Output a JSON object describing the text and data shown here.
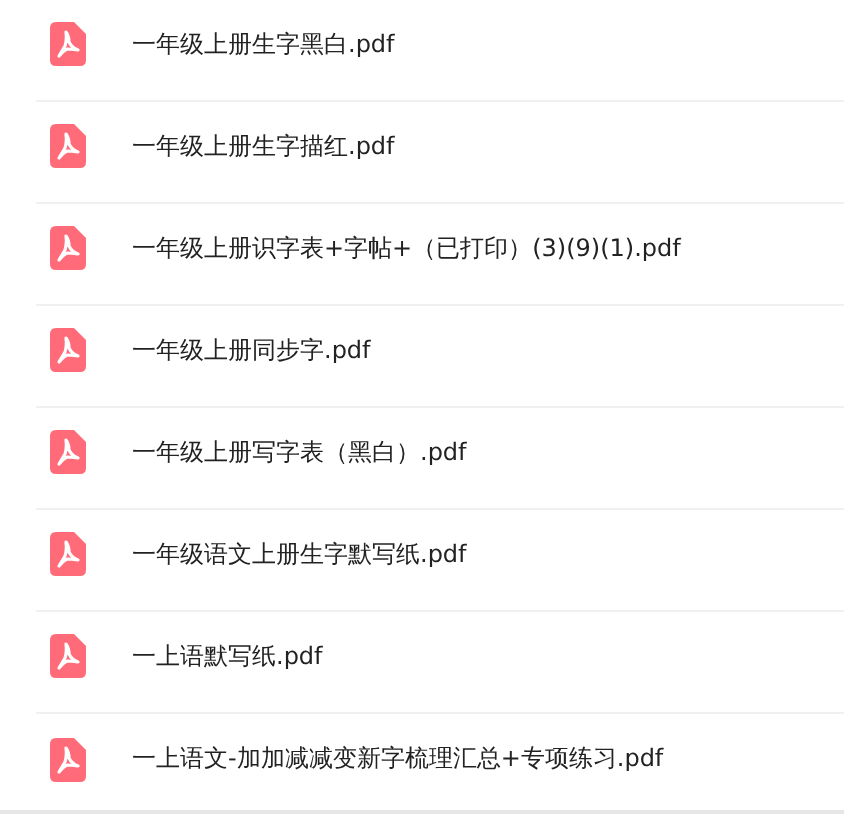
{
  "files": [
    {
      "name": "一年级上册生字黑白.pdf",
      "kind": "pdf"
    },
    {
      "name": "一年级上册生字描红.pdf",
      "kind": "pdf"
    },
    {
      "name": "一年级上册识字表+字帖+（已打印）(3)(9)(1).pdf",
      "kind": "pdf"
    },
    {
      "name": "一年级上册同步字.pdf",
      "kind": "pdf"
    },
    {
      "name": "一年级上册写字表（黑白）.pdf",
      "kind": "pdf"
    },
    {
      "name": "一年级语文上册生字默写纸.pdf",
      "kind": "pdf"
    },
    {
      "name": "一上语默写纸.pdf",
      "kind": "pdf"
    },
    {
      "name": "一上语文-加加减减变新字梳理汇总+专项练习.pdf",
      "kind": "pdf"
    }
  ]
}
